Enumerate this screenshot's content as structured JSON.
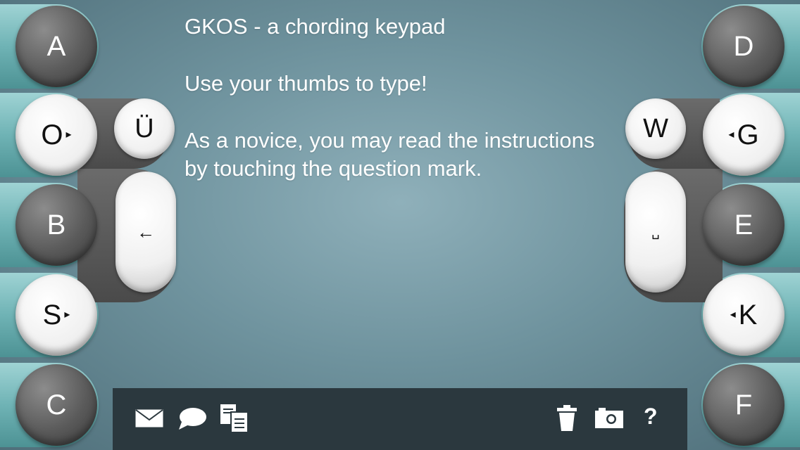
{
  "keys": {
    "a": "A",
    "o": "O",
    "b": "B",
    "s": "S",
    "c": "C",
    "d": "D",
    "g": "G",
    "e": "E",
    "k": "K",
    "f": "F",
    "u_umlaut": "Ü",
    "w": "W",
    "backspace": "←",
    "space": "␣",
    "arrow_right": "▸",
    "arrow_left": "◂"
  },
  "content": {
    "title": "GKOS - a chording keypad",
    "line1": "Use your thumbs to type!",
    "line2": "As a novice, you may read the instructions by touching the question mark."
  },
  "toolbar": {
    "help_label": "?",
    "icons": [
      "mail-icon",
      "chat-icon",
      "copy-icon",
      "trash-icon",
      "camera-icon",
      "help-icon"
    ]
  },
  "colors": {
    "tab": "#6fb3b5",
    "dark_key": "#5a5a5a",
    "light_key": "#f0f0f0",
    "toolbar": "#2b383e"
  }
}
